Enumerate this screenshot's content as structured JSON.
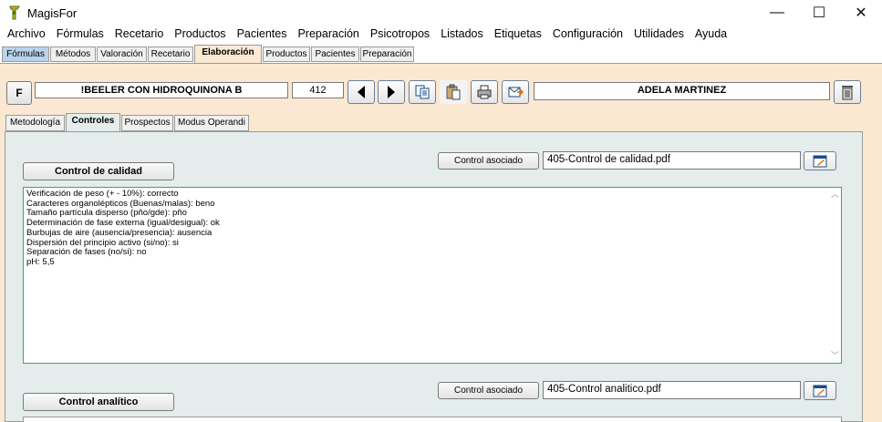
{
  "window": {
    "title": "MagisFor",
    "minimize": "—",
    "maximize": "☐",
    "close": "✕"
  },
  "menu": [
    "Archivo",
    "Fórmulas",
    "Recetario",
    "Productos",
    "Pacientes",
    "Preparación",
    "Psicotropos",
    "Listados",
    "Etiquetas",
    "Configuración",
    "Utilidades",
    "Ayuda"
  ],
  "main_tabs": [
    "Fórmulas",
    "Métodos",
    "Valoración",
    "Recetario",
    "Elaboración",
    "Productos",
    "Pacientes",
    "Preparación"
  ],
  "active_main_tab": "Elaboración",
  "toolbar": {
    "f_button": "F",
    "formula_name": "!BEELER CON HIDROQUINONA B",
    "formula_number": "412",
    "patient_name": "ADELA MARTINEZ"
  },
  "sub_tabs": [
    "Metodología",
    "Controles",
    "Prospectos",
    "Modus Operandi"
  ],
  "active_sub_tab": "Controles",
  "quality_control": {
    "button_label": "Control de calidad",
    "associated_button": "Control asociado",
    "associated_file": "405-Control de calidad.pdf",
    "lines": [
      "Verificación de peso (+ - 10%): correcto",
      "Caracteres organolépticos (Buenas/malas): beno",
      "Tamaño partícula disperso (pño/gde): pño",
      "Determinación de fase externa (igual/desigual): ok",
      "Burbujas de aire (ausencia/presencia): ausencia",
      "Dispersión del principio activo (si/no): si",
      "Separación de fases (no/si): no",
      "pH: 5,5"
    ]
  },
  "analytic_control": {
    "button_label": "Control analítico",
    "associated_button": "Control asociado",
    "associated_file": "405-Control analitico.pdf"
  },
  "colors": {
    "content_bg": "#fbe8d2",
    "panel_bg": "#e4ecec",
    "textarea_border": "#3fae3f"
  }
}
